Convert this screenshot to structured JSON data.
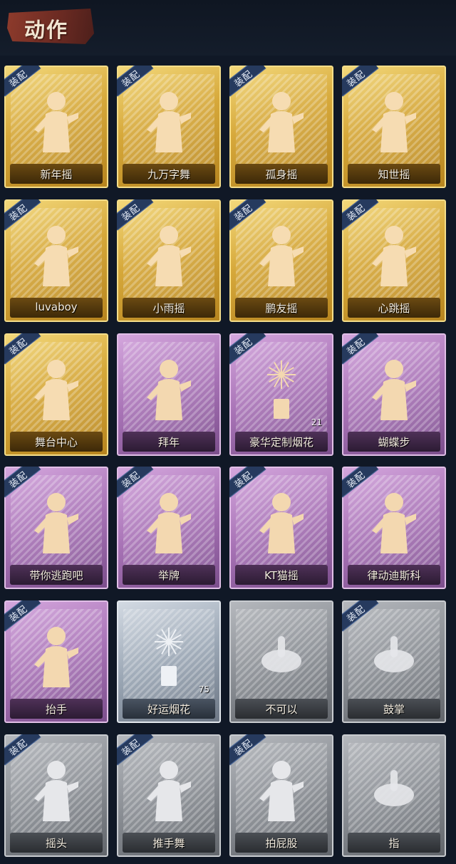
{
  "header": {
    "title": "动作"
  },
  "badge_label": "装配",
  "colors": {
    "gold": "#d6a83a",
    "purple": "#a873b6",
    "silver": "#9aa6b4",
    "gray": "#8a8e94",
    "badge": "#263a5e",
    "title_plate": "#8e3b2c"
  },
  "actions": [
    {
      "label": "新年摇",
      "tier": "gold",
      "equipped": true,
      "icon": "dance-figure-icon"
    },
    {
      "label": "九万字舞",
      "tier": "gold",
      "equipped": true,
      "icon": "dance-figure-icon"
    },
    {
      "label": "孤身摇",
      "tier": "gold",
      "equipped": true,
      "icon": "dance-figure-icon"
    },
    {
      "label": "知世摇",
      "tier": "gold",
      "equipped": true,
      "icon": "dance-figure-icon"
    },
    {
      "label": "luvaboy",
      "tier": "gold",
      "equipped": true,
      "icon": "dance-figure-icon"
    },
    {
      "label": "小雨摇",
      "tier": "gold",
      "equipped": true,
      "icon": "dance-figure-icon"
    },
    {
      "label": "鹏友摇",
      "tier": "gold",
      "equipped": true,
      "icon": "dance-figure-icon"
    },
    {
      "label": "心跳摇",
      "tier": "gold",
      "equipped": true,
      "icon": "dance-figure-icon"
    },
    {
      "label": "舞台中心",
      "tier": "gold",
      "equipped": true,
      "icon": "dance-figure-icon"
    },
    {
      "label": "拜年",
      "tier": "purple",
      "equipped": false,
      "icon": "bow-figure-icon"
    },
    {
      "label": "豪华定制烟花",
      "tier": "purple",
      "equipped": true,
      "icon": "fireworks-box-icon",
      "count": "21"
    },
    {
      "label": "蝴蝶步",
      "tier": "purple",
      "equipped": true,
      "icon": "dance-figure-icon"
    },
    {
      "label": "带你逃跑吧",
      "tier": "purple",
      "equipped": true,
      "icon": "dance-figure-icon"
    },
    {
      "label": "举牌",
      "tier": "purple",
      "equipped": true,
      "icon": "sign-holding-figure-icon"
    },
    {
      "label": "KT猫摇",
      "tier": "purple",
      "equipped": true,
      "icon": "dance-figure-icon"
    },
    {
      "label": "律动迪斯科",
      "tier": "purple",
      "equipped": true,
      "icon": "dance-figure-icon"
    },
    {
      "label": "抬手",
      "tier": "purple",
      "equipped": true,
      "icon": "raise-hand-figure-icon"
    },
    {
      "label": "好运烟花",
      "tier": "silver",
      "equipped": false,
      "icon": "firework-cylinder-icon",
      "count": "75"
    },
    {
      "label": "不可以",
      "tier": "gray",
      "equipped": false,
      "icon": "finger-wag-icon"
    },
    {
      "label": "鼓掌",
      "tier": "gray",
      "equipped": true,
      "icon": "clapping-hands-icon"
    },
    {
      "label": "摇头",
      "tier": "gray",
      "equipped": true,
      "icon": "shake-head-figure-icon"
    },
    {
      "label": "推手舞",
      "tier": "gray",
      "equipped": true,
      "icon": "push-hand-figure-icon"
    },
    {
      "label": "拍屁股",
      "tier": "gray",
      "equipped": true,
      "icon": "spank-figure-icon"
    },
    {
      "label": "指",
      "tier": "gray",
      "equipped": false,
      "icon": "pointing-hand-icon"
    }
  ]
}
